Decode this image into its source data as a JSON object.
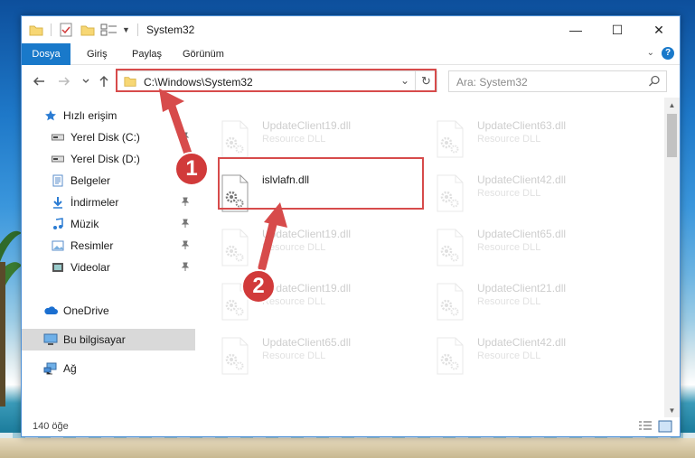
{
  "window": {
    "title": "System32",
    "controls": {
      "minimize": "—",
      "maximize": "☐",
      "close": "✕"
    }
  },
  "ribbon": {
    "tabs": [
      "Dosya",
      "Giriş",
      "Paylaş",
      "Görünüm"
    ],
    "help_icon": "?"
  },
  "nav": {
    "address": "C:\\Windows\\System32",
    "search_placeholder": "Ara: System32"
  },
  "sidebar": {
    "items": [
      {
        "label": "Hızlı erişim",
        "icon": "star-icon"
      },
      {
        "label": "Yerel Disk (C:)",
        "icon": "drive-icon",
        "pinned": true
      },
      {
        "label": "Yerel Disk (D:)",
        "icon": "drive-icon",
        "pinned": true
      },
      {
        "label": "Belgeler",
        "icon": "documents-icon",
        "pinned": true
      },
      {
        "label": "İndirmeler",
        "icon": "download-icon",
        "pinned": true
      },
      {
        "label": "Müzik",
        "icon": "music-icon",
        "pinned": true
      },
      {
        "label": "Resimler",
        "icon": "pictures-icon",
        "pinned": true
      },
      {
        "label": "Videolar",
        "icon": "videos-icon",
        "pinned": true
      },
      {
        "label": "OneDrive",
        "icon": "cloud-icon"
      },
      {
        "label": "Bu bilgisayar",
        "icon": "computer-icon",
        "selected": true
      },
      {
        "label": "Ağ",
        "icon": "network-icon"
      }
    ]
  },
  "files": [
    {
      "name": "UpdateClient19.dll",
      "type": "Resource DLL",
      "faded": true
    },
    {
      "name": "UpdateClient63.dll",
      "type": "Resource DLL",
      "faded": true
    },
    {
      "name": "islvlafn.dll",
      "type": "",
      "faded": false
    },
    {
      "name": "UpdateClient42.dll",
      "type": "Resource DLL",
      "faded": true
    },
    {
      "name": "UpdateClient19.dll",
      "type": "Resource DLL",
      "faded": true
    },
    {
      "name": "UpdateClient65.dll",
      "type": "Resource DLL",
      "faded": true
    },
    {
      "name": "UpdateClient19.dll",
      "type": "Resource DLL",
      "faded": true
    },
    {
      "name": "UpdateClient21.dll",
      "type": "Resource DLL",
      "faded": true
    },
    {
      "name": "UpdateClient65.dll",
      "type": "Resource DLL",
      "faded": true
    },
    {
      "name": "UpdateClient42.dll",
      "type": "Resource DLL",
      "faded": true
    }
  ],
  "status": {
    "count": "140 öğe"
  },
  "annotations": {
    "step1": "1",
    "step2": "2",
    "accent": "#d74b4b"
  }
}
